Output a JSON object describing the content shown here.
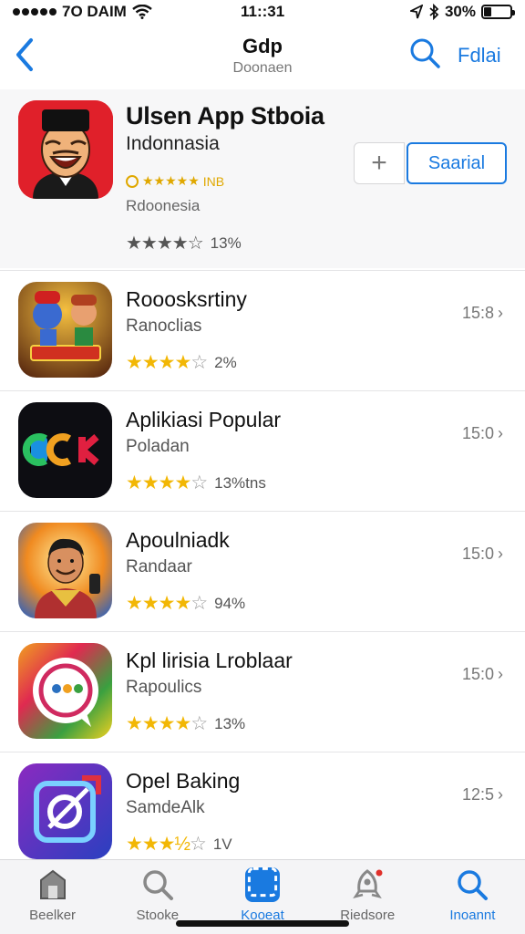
{
  "status_bar": {
    "carrier": "••••◦•◦• •• PAIM",
    "carrier_text": "7O DAIM",
    "time": "11::31",
    "battery": "30%",
    "battery_level": 0.3
  },
  "nav": {
    "title": "Gdp",
    "subtitle": "Doonaen",
    "action": "Fdlai"
  },
  "featured": {
    "title": "Ulsen App Stboia",
    "subtitle": "Indonnasia",
    "badge": "INB",
    "meta": "Rdoonesia",
    "rating_count": "13%",
    "install_label": "Saarial",
    "rating_value": 3.5,
    "accent": "#1a7ae0"
  },
  "apps": [
    {
      "title": "Rooosksrtiny",
      "subtitle": "Ranoclias",
      "rating_count": "2%",
      "size": "15:8",
      "rating_value": 4
    },
    {
      "title": "Aplikiasi Popular",
      "subtitle": "Poladan",
      "rating_count": "13%tns",
      "size": "15:0",
      "rating_value": 4
    },
    {
      "title": "Apoulniadk",
      "subtitle": "Randaar",
      "rating_count": "94%",
      "size": "15:0",
      "rating_value": 4
    },
    {
      "title": "Kpl lirisia Lroblaar",
      "subtitle": "Rapoulics",
      "rating_count": "13%",
      "size": "15:0",
      "rating_value": 4
    },
    {
      "title": "Opel Baking",
      "subtitle": "SamdeAlk",
      "rating_count": "1V",
      "size": "12:5",
      "rating_value": 3.5
    }
  ],
  "tabs": [
    {
      "label": "Beelker",
      "icon": "home-icon"
    },
    {
      "label": "Stooke",
      "icon": "search-icon"
    },
    {
      "label": "Kooeat",
      "icon": "apps-icon"
    },
    {
      "label": "Riedsore",
      "icon": "rocket-icon"
    },
    {
      "label": "Inoannt",
      "icon": "search-icon"
    }
  ],
  "colors": {
    "blue": "#1a7ae0",
    "star": "#f2b705"
  }
}
